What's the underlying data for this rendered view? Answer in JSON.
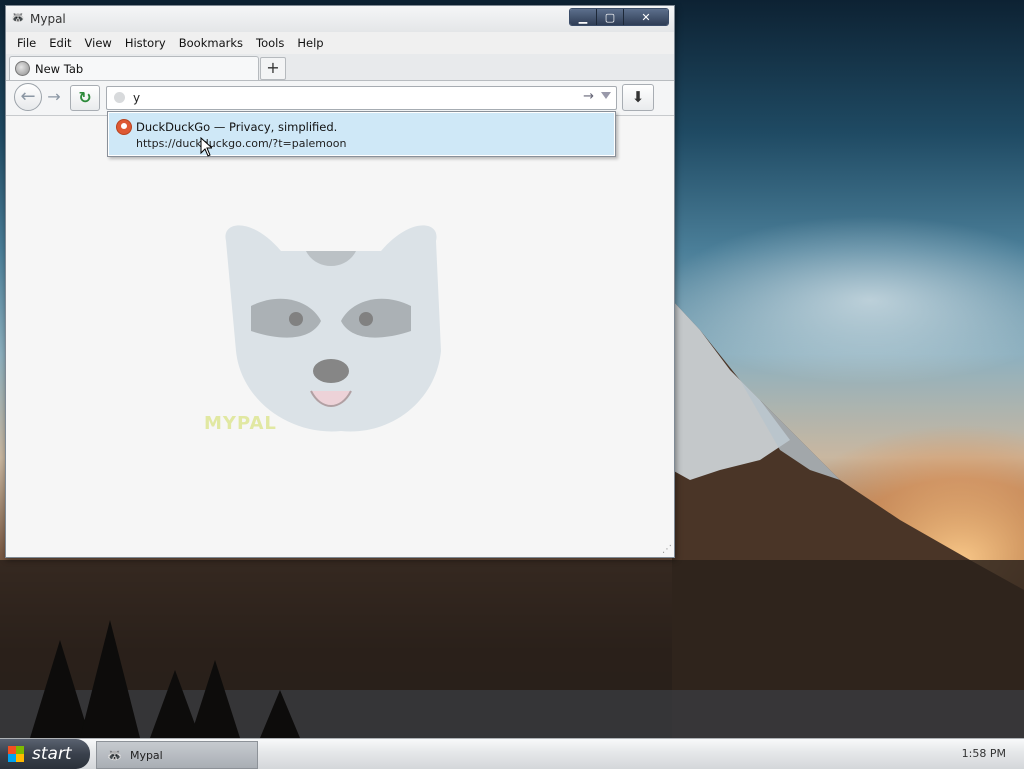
{
  "window": {
    "title": "Mypal",
    "app_icon": "raccoon-icon",
    "caption_minimize": "▁",
    "caption_maximize": "▢",
    "caption_close": "✕"
  },
  "menubar": {
    "items": [
      "File",
      "Edit",
      "View",
      "History",
      "Bookmarks",
      "Tools",
      "Help"
    ]
  },
  "tabs": {
    "active_tab_label": "New Tab",
    "new_tab_symbol": "+"
  },
  "navbar": {
    "back_symbol": "←",
    "forward_symbol": "→",
    "reload_symbol": "↻",
    "url_value": "y",
    "go_symbol": "→",
    "download_symbol": "⬇"
  },
  "autocomplete": {
    "title": "DuckDuckGo — Privacy, simplified.",
    "url": "https://duckduckgo.com/?t=palemoon"
  },
  "content": {
    "brand_logo_text": "MYPAL"
  },
  "taskbar": {
    "start_label": "start",
    "task_label": "Mypal",
    "clock": "1:58 PM"
  },
  "colors": {
    "accent_highlight": "#cfe8f7",
    "ddg_orange": "#de5833",
    "reload_green": "#2c8a3a"
  }
}
